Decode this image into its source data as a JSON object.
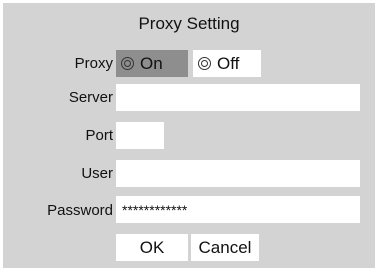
{
  "dialog": {
    "title": "Proxy Setting"
  },
  "proxy": {
    "label": "Proxy",
    "on_label": "On",
    "off_label": "Off",
    "selected": "On"
  },
  "server": {
    "label": "Server",
    "value": ""
  },
  "port": {
    "label": "Port",
    "value": ""
  },
  "user": {
    "label": "User",
    "value": ""
  },
  "password": {
    "label": "Password",
    "value": "************"
  },
  "buttons": {
    "ok_label": "OK",
    "cancel_label": "Cancel"
  }
}
